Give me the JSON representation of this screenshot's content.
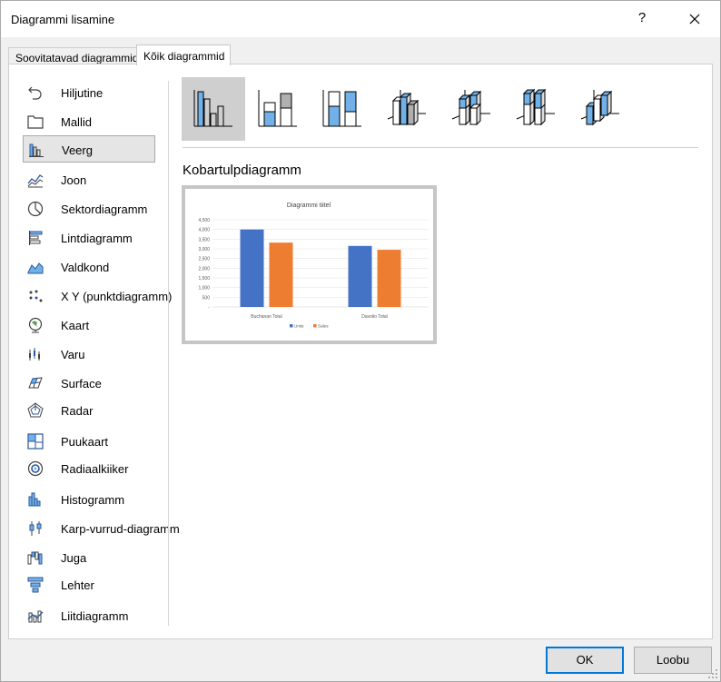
{
  "window": {
    "title": "Diagrammi lisamine",
    "help_label": "?",
    "close_label": "×"
  },
  "tabs": [
    {
      "label": "Soovitatavad diagrammid",
      "active": false
    },
    {
      "label": "Kõik diagrammid",
      "active": true
    }
  ],
  "sidebar": {
    "items": [
      {
        "label": "Hiljutine",
        "icon": "undo-icon"
      },
      {
        "label": "Mallid",
        "icon": "folder-icon"
      },
      {
        "label": "Veerg",
        "icon": "column-chart-icon",
        "selected": true
      },
      {
        "label": "Joon",
        "icon": "line-chart-icon"
      },
      {
        "label": "Sektordiagramm",
        "icon": "pie-chart-icon"
      },
      {
        "label": "Lintdiagramm",
        "icon": "bar-chart-icon"
      },
      {
        "label": "Valdkond",
        "icon": "area-chart-icon"
      },
      {
        "label": "X Y (punktdiagramm)",
        "icon": "scatter-chart-icon"
      },
      {
        "label": "Kaart",
        "icon": "globe-icon"
      },
      {
        "label": "Varu",
        "icon": "stock-chart-icon"
      },
      {
        "label": "Surface",
        "icon": "surface-chart-icon"
      },
      {
        "label": "Radar",
        "icon": "radar-chart-icon"
      },
      {
        "label": "Puukaart",
        "icon": "treemap-icon"
      },
      {
        "label": "Radiaalkiiker",
        "icon": "sunburst-icon"
      },
      {
        "label": "Histogramm",
        "icon": "histogram-icon"
      },
      {
        "label": "Karp-vurrud-diagramm",
        "icon": "box-whisker-icon"
      },
      {
        "label": "Juga",
        "icon": "waterfall-icon"
      },
      {
        "label": "Lehter",
        "icon": "funnel-icon"
      },
      {
        "label": "Liitdiagramm",
        "icon": "combo-chart-icon"
      }
    ]
  },
  "subtypes": [
    {
      "icon": "clustered-column-icon",
      "selected": true
    },
    {
      "icon": "stacked-column-icon",
      "selected": false
    },
    {
      "icon": "stacked-100-column-icon",
      "selected": false
    },
    {
      "icon": "3d-clustered-column-icon",
      "selected": false
    },
    {
      "icon": "3d-stacked-column-icon",
      "selected": false
    },
    {
      "icon": "3d-stacked-100-column-icon",
      "selected": false
    },
    {
      "icon": "3d-column-icon",
      "selected": false
    }
  ],
  "selected_subtype_name": "Kobartulpdiagramm",
  "chart_data": {
    "type": "bar",
    "title": "Diagrammi tiitel",
    "categories": [
      "Buchanan Total",
      "Davolio Total"
    ],
    "series": [
      {
        "name": "Units",
        "values": [
          4000,
          3150
        ],
        "color": "#4472c4"
      },
      {
        "name": "Sales",
        "values": [
          3320,
          2950
        ],
        "color": "#ed7d31"
      }
    ],
    "yticks": [
      "-",
      "500",
      "1,000",
      "1,500",
      "2,000",
      "2,500",
      "3,000",
      "3,500",
      "4,000",
      "4,500"
    ],
    "ylim": [
      0,
      4500
    ],
    "grid": true,
    "legend": "bottom"
  },
  "footer": {
    "ok_label": "OK",
    "cancel_label": "Loobu"
  }
}
